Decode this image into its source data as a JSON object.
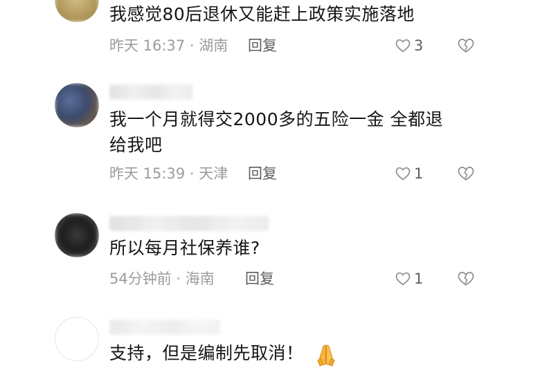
{
  "comments": [
    {
      "text_lines": [
        "我感觉80后退休又能赶上政策实施落地"
      ],
      "time_location": "昨天 16:37 · 湖南",
      "reply_label": "回复",
      "like_count": "3"
    },
    {
      "text_lines": [
        "我一个月就得交2000多的五险一金 全都退",
        "给我吧"
      ],
      "time_location": "昨天 15:39 · 天津",
      "reply_label": "回复",
      "like_count": "1"
    },
    {
      "text_lines": [
        "所以每月社保养谁?"
      ],
      "time_location": "54分钟前 · 海南",
      "reply_label": "回复",
      "like_count": "1"
    },
    {
      "text_lines": [
        "支持，但是编制先取消！"
      ],
      "emoji": "folded-hands-emoji"
    }
  ],
  "icons": {
    "like": "heart-outline-icon",
    "dislike": "broken-heart-icon"
  },
  "colors": {
    "text": "#161616",
    "meta": "#9b9b9b",
    "action": "#5e5e5e"
  }
}
